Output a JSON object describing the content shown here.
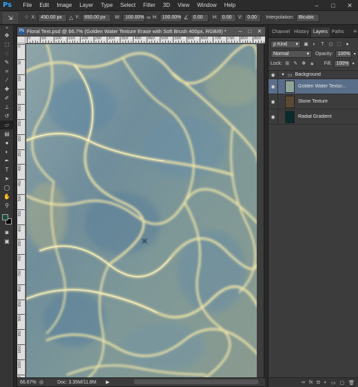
{
  "app": {
    "logo": "Ps"
  },
  "menu": [
    "File",
    "Edit",
    "Image",
    "Layer",
    "Type",
    "Select",
    "Filter",
    "3D",
    "View",
    "Window",
    "Help"
  ],
  "window_controls": [
    "–",
    "□",
    "✕"
  ],
  "options": {
    "x_label": "X:",
    "x_value": "450.00 px",
    "y_label": "Y:",
    "y_value": "650.00 px",
    "w_label": "W:",
    "w_value": "100.00%",
    "h_label": "H:",
    "h_value": "100.00%",
    "angle_value": "0.00",
    "hskew_label": "H:",
    "hskew_value": "0.00",
    "vskew_label": "V:",
    "vskew_value": "0.00",
    "interp_label": "Interpolation:",
    "interp_value": "Bicubic"
  },
  "document": {
    "title": "Floral Text.psd @ 66.7% (Golden Water Texture    Erase with Soft Brush 400px, RGB/8) *",
    "ruler_h": [
      "0",
      "50",
      "100",
      "150",
      "200",
      "250",
      "300",
      "350",
      "400",
      "450",
      "500",
      "550",
      "600",
      "650",
      "700",
      "750",
      "800",
      "850"
    ],
    "ruler_v": [
      "0",
      "50",
      "100",
      "150",
      "200",
      "250",
      "300",
      "350",
      "400",
      "450",
      "500",
      "550",
      "600",
      "650",
      "700",
      "750",
      "800",
      "850",
      "900",
      "950",
      "1000",
      "1050",
      "1100"
    ],
    "zoom": "66.67%",
    "doc_size": "Doc: 3.35M/11.8M"
  },
  "layers_panel": {
    "tabs": [
      "Channel",
      "History",
      "Layers",
      "Paths"
    ],
    "active_tab": "Layers",
    "kind_label": "ρ Kind",
    "blend_mode": "Normal",
    "opacity_label": "Opacity:",
    "opacity_value": "100%",
    "lock_label": "Lock:",
    "fill_label": "Fill:",
    "fill_value": "100%",
    "group_name": "Background",
    "layers": [
      {
        "name": "Golden Water Textur...",
        "selected": true,
        "thumb_color": "#8fa59a"
      },
      {
        "name": "Stone Texture",
        "selected": false,
        "thumb_color": "#5b4a33"
      },
      {
        "name": "Radial Gradient",
        "selected": false,
        "thumb_color": "#0d2a2a"
      }
    ]
  },
  "colors": {
    "foreground": "#1f4d42",
    "background": "#000000",
    "accent": "#31a8ff"
  }
}
